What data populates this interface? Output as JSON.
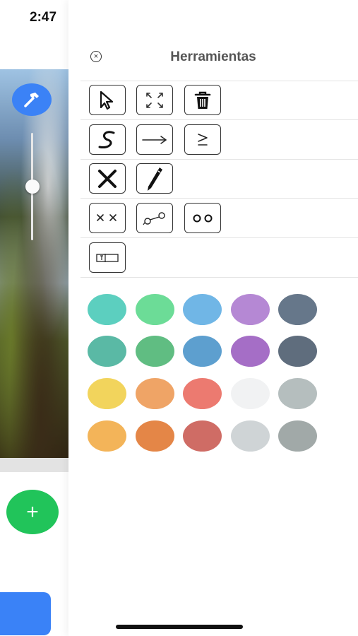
{
  "status_bar": {
    "time": "2:47"
  },
  "panel": {
    "title": "Herramientas",
    "close_icon": "close-circle-icon"
  },
  "tools": [
    [
      {
        "name": "pointer-tool",
        "icon": "cursor-arrow-icon"
      },
      {
        "name": "expand-tool",
        "icon": "expand-arrows-icon"
      },
      {
        "name": "delete-tool",
        "icon": "trash-icon"
      }
    ],
    [
      {
        "name": "curve-tool",
        "icon": "s-curve-icon"
      },
      {
        "name": "arrow-tool",
        "icon": "arrow-right-icon"
      },
      {
        "name": "zigzag-tool",
        "icon": "zigzag-icon"
      }
    ],
    [
      {
        "name": "cross-tool",
        "icon": "x-mark-icon"
      },
      {
        "name": "pen-tool",
        "icon": "pen-icon"
      }
    ],
    [
      {
        "name": "double-cross-tool",
        "icon": "double-x-icon"
      },
      {
        "name": "link-tool",
        "icon": "connected-nodes-icon"
      },
      {
        "name": "double-circle-tool",
        "icon": "double-circle-icon"
      }
    ],
    [
      {
        "name": "text-field-tool",
        "icon": "text-box-icon"
      }
    ]
  ],
  "colors": [
    [
      "#5ccfbf",
      "#6cdc97",
      "#70b6e6",
      "#b588d4",
      "#66778a"
    ],
    [
      "#5ab9a5",
      "#60bd82",
      "#5d9fcf",
      "#a56ec6",
      "#5f6d7d"
    ],
    [
      "#f2d45c",
      "#efa466",
      "#ec7a70",
      "#f1f2f3",
      "#b5bebe"
    ],
    [
      "#f3b459",
      "#e48647",
      "#cf6c65",
      "#cfd4d6",
      "#a1a9a8"
    ]
  ],
  "background_app": {
    "hammer_icon": "hammer-icon",
    "add_button_label": "+"
  }
}
